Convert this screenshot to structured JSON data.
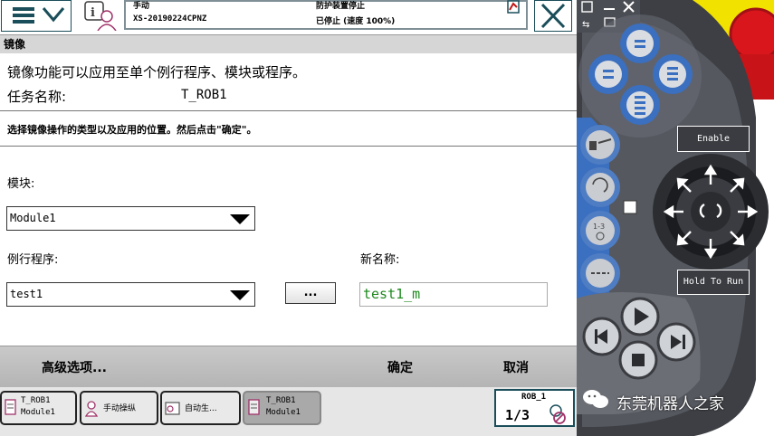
{
  "header": {
    "mode": "手动",
    "controller_id": "XS-20190224CPNZ",
    "guard_status": "防护装置停止",
    "run_status": "已停止 (速度 100%)"
  },
  "window_title": "镜像",
  "main": {
    "intro": "镜像功能可以应用至单个例行程序、模块或程序。",
    "task_label": "任务名称:",
    "task_value": "T_ROB1",
    "instruction": "选择镜像操作的类型以及应用的位置。然后点击\"确定\"。",
    "module_label": "模块:",
    "module_value": "Module1",
    "routine_label": "例行程序:",
    "routine_value": "test1",
    "browse_label": "...",
    "newname_label": "新名称:",
    "newname_value": "test1_m"
  },
  "actions": {
    "advanced": "高级选项...",
    "ok": "确定",
    "cancel": "取消"
  },
  "taskbar": {
    "items": [
      {
        "line1": "T_ROB1",
        "line2": "Module1"
      },
      {
        "line1": "手动操纵",
        "line2": ""
      },
      {
        "line1": "自动生...",
        "line2": ""
      },
      {
        "line1": "T_ROB1",
        "line2": "Module1"
      }
    ],
    "robot_label": "ROB_1",
    "fraction": "1/3"
  },
  "pendant": {
    "enable_label": "Enable",
    "hold_label": "Hold To Run"
  },
  "watermark": "东莞机器人之家",
  "colors": {
    "accent": "#1a4e5a",
    "green_text": "#1f8a1f",
    "pendant_blue": "#3b6fbf",
    "estop_red": "#d9161c",
    "yellow": "#f2e200"
  }
}
